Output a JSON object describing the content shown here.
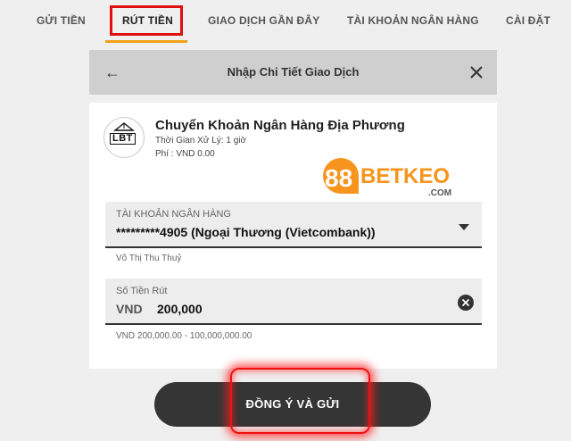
{
  "tabs": [
    {
      "label": "GỬI TIỀN"
    },
    {
      "label": "RÚT TIỀN"
    },
    {
      "label": "GIAO DỊCH GẦN ĐÂY"
    },
    {
      "label": "TÀI KHOẢN NGÂN HÀNG"
    },
    {
      "label": "CÀI ĐẶT"
    }
  ],
  "colors": {
    "accent": "#f0a21a",
    "highlight": "#e01010",
    "button": "#353535",
    "brand_orange": "#f7941d"
  },
  "header": {
    "title": "Nhập Chi Tiết Giao Dịch",
    "back_icon": "arrow-left-icon",
    "close_icon": "close-icon"
  },
  "bank": {
    "logo_text": "LBT",
    "name": "Chuyển Khoản Ngân Hàng Địa Phương",
    "processing_time": "Thời Gian Xử Lý: 1 giờ",
    "fee": "Phí : VND 0.00"
  },
  "brand": {
    "number": "88",
    "name": "BETKEO",
    "domain": ".COM"
  },
  "account_field": {
    "label": "TÀI KHOẢN NGÂN HÀNG",
    "value": "*********4905 (Ngoại Thương (Vietcombank))",
    "holder": "Võ Thị Thu Thuỷ"
  },
  "amount_field": {
    "label": "Số Tiền Rút",
    "currency": "VND",
    "value": "200,000",
    "range": "VND 200,000.00 - 100,000,000.00"
  },
  "submit": {
    "label": "ĐỒNG Ý VÀ GỬI"
  }
}
